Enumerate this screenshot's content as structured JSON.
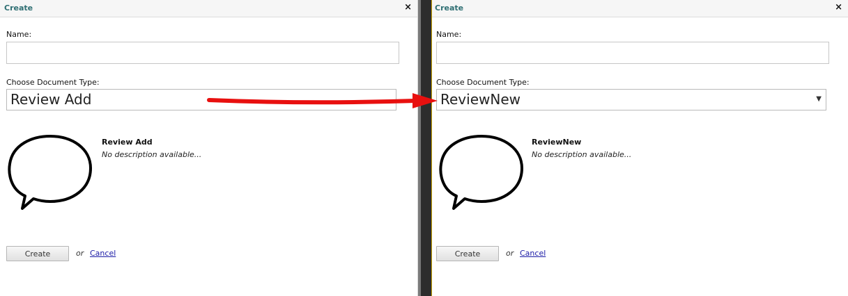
{
  "left_dialog": {
    "title": "Create",
    "close_symbol": "×",
    "name_label": "Name:",
    "name_value": "",
    "doctype_label": "Choose Document Type:",
    "doctype_selected": "Review Add",
    "doc_title": "Review Add",
    "doc_description": "No description available...",
    "create_label": "Create",
    "or_text": "or",
    "cancel_label": "Cancel"
  },
  "right_dialog": {
    "title": "Create",
    "close_symbol": "×",
    "name_label": "Name:",
    "name_value": "",
    "doctype_label": "Choose Document Type:",
    "doctype_selected": "ReviewNew",
    "dropdown_arrow": "▼",
    "doc_title": "ReviewNew",
    "doc_description": "No description available...",
    "create_label": "Create",
    "or_text": "or",
    "cancel_label": "Cancel"
  },
  "colors": {
    "title_text": "#2f6f73",
    "link": "#1a1aa6",
    "arrow": "#e8100f",
    "gutter": "#2d2d2d"
  },
  "icons": {
    "document_type_icon": "speech-bubble-icon",
    "annotation": "red-arrow"
  }
}
